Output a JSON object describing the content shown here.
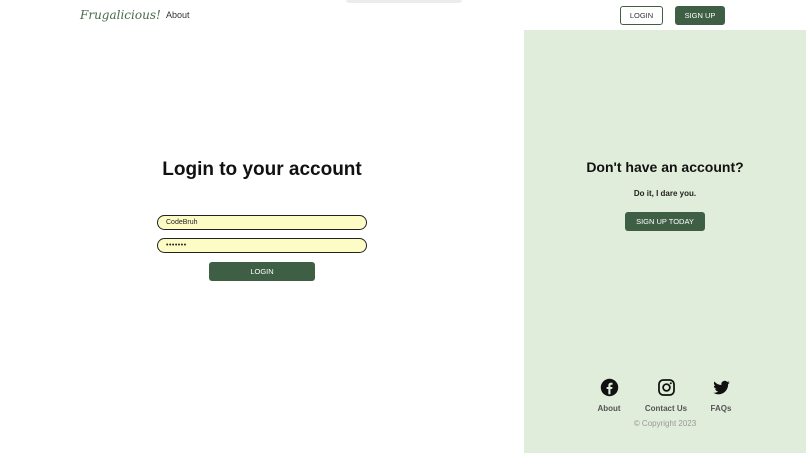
{
  "header": {
    "brand": "Frugalicious!",
    "about": "About",
    "login_button": "LOGIN",
    "signup_button": "SIGN UP"
  },
  "login": {
    "title": "Login to your account",
    "username_value": "CodeBruh",
    "password_value": "•••••••",
    "submit_label": "LOGIN"
  },
  "signup_panel": {
    "title": "Don't have an account?",
    "subtitle": "Do it, I dare you.",
    "cta_label": "SIGN UP TODAY"
  },
  "footer": {
    "links": [
      {
        "label": "About",
        "icon": "facebook-icon"
      },
      {
        "label": "Contact Us",
        "icon": "instagram-icon"
      },
      {
        "label": "FAQs",
        "icon": "twitter-icon"
      }
    ],
    "copyright": "© Copyright 2023"
  },
  "colors": {
    "accent": "#3f5f45",
    "panel_bg": "#e0edda",
    "input_bg": "#fdfcc5"
  }
}
